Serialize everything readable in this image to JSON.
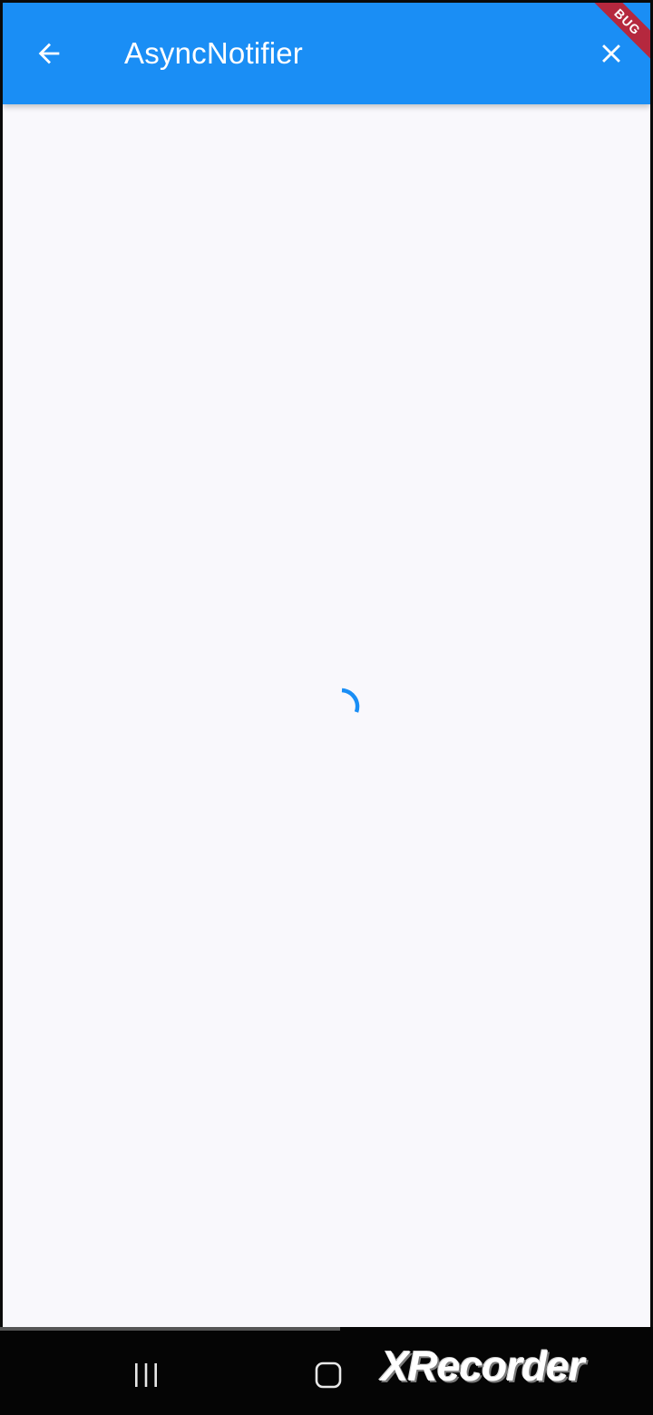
{
  "app_bar": {
    "title": "AsyncNotifier",
    "back_icon": "arrow-back-icon",
    "close_icon": "close-icon",
    "background_color": "#1a8ef5"
  },
  "debug_banner": {
    "label": "BUG"
  },
  "content": {
    "loading_indicator": "circular-progress-icon",
    "indicator_color": "#1a8ef5",
    "background_color": "#f9f8fc"
  },
  "nav_bar": {
    "recents_icon": "recents-icon",
    "home_icon": "home-icon"
  },
  "watermark": {
    "text": "XRecorder"
  }
}
